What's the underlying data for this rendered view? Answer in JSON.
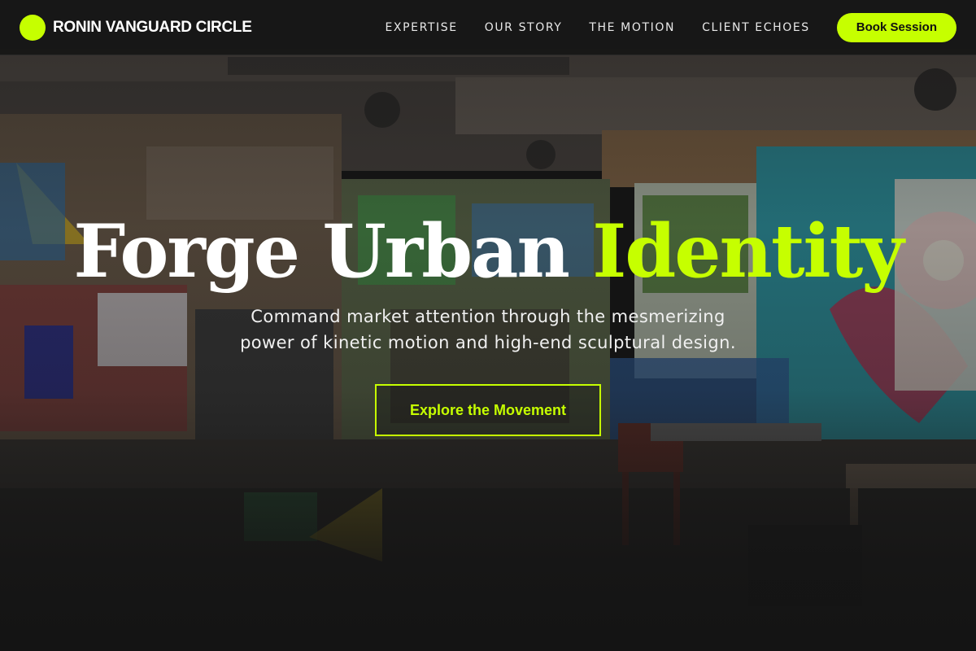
{
  "brand": {
    "name": "RONIN VANGUARD CIRCLE",
    "accent_color": "#c6ff00"
  },
  "nav": {
    "items": [
      {
        "label": "EXPERTISE"
      },
      {
        "label": "OUR STORY"
      },
      {
        "label": "THE MOTION"
      },
      {
        "label": "CLIENT ECHOES"
      }
    ],
    "cta_label": "Book Session"
  },
  "hero": {
    "title_part1": "Forge Urban ",
    "title_accent": "Identity",
    "subtitle_line1": "Command market attention through the mesmerizing",
    "subtitle_line2": "power of kinetic motion and high-end sculptural design.",
    "cta_label": "Explore the Movement",
    "background": "graffiti-covered industrial loft with chairs, tables and cables"
  }
}
